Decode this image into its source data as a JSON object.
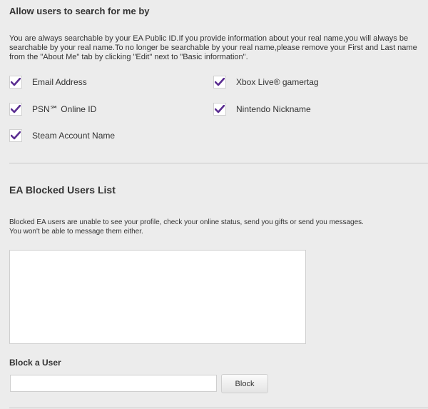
{
  "search": {
    "title": "Allow users to search for me by",
    "description": "You are always searchable by your EA Public ID.If you provide information about your real name,you will always be searchable by your real name.To no longer be searchable by your real name,please remove your First and Last name from the \"About Me\" tab by clicking \"Edit\" next to \"Basic information\".",
    "options": [
      {
        "label": "Email Address",
        "checked": true
      },
      {
        "label": "Xbox Live® gamertag",
        "checked": true
      },
      {
        "label": "PSN℠ Online ID",
        "checked": true
      },
      {
        "label": "Nintendo Nickname",
        "checked": true
      },
      {
        "label": "Steam Account Name",
        "checked": true
      }
    ],
    "check_color": "#5a2d91"
  },
  "blocked": {
    "title": "EA Blocked Users List",
    "description_line1": "Blocked EA users are unable to see your profile, check your online status, send you gifts or send you messages.",
    "description_line2": "You won't be able to message them either."
  },
  "block_user": {
    "title": "Block a User",
    "input_value": "",
    "button_label": "Block"
  }
}
